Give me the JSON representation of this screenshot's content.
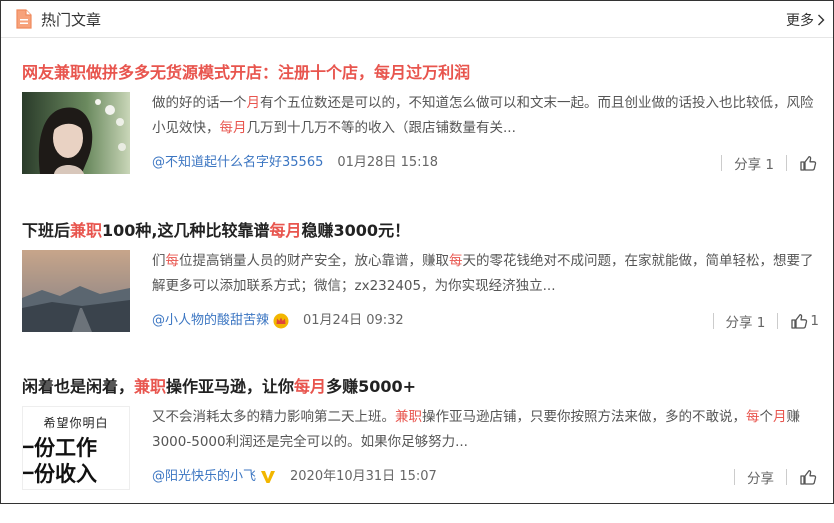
{
  "header": {
    "title": "热门文章",
    "more": "更多"
  },
  "articles": [
    {
      "title_parts": [
        "网友",
        "兼职",
        "做拼多多无货源模式开店：注册十个店，",
        "每月",
        "过万利润"
      ],
      "excerpt_parts": [
        "做的好的话一个",
        "月",
        "有个五位数还是可以的，不知道怎么做可以和文末一起。而且创业做的话投入也比较低，风险小见效快，",
        "每月",
        "几万到十几万不等的收入（跟店铺数量有关..."
      ],
      "author": "@不知道起什么名字好35565",
      "date": "01月28日 15:18",
      "share": "分享 1",
      "likes": ""
    },
    {
      "title_parts": [
        "下班后",
        "兼职",
        "100种,这几种比较靠谱",
        "每月",
        "稳赚3000元！"
      ],
      "excerpt_parts": [
        "们",
        "每",
        "位提高销量人员的财产安全，放心靠谱，赚取",
        "每",
        "天的零花钱绝对不成问题，在家就能做，简单轻松，想要了解更多可以添加联系方式；微信；zx232405，为你实现经济独立..."
      ],
      "author": "@小人物的酸甜苦辣",
      "date": "01月24日 09:32",
      "share": "分享 1",
      "likes": "1"
    },
    {
      "title_parts": [
        "闲着也是闲着，",
        "兼职",
        "操作亚马逊，让你",
        "每月",
        "多赚5000+"
      ],
      "excerpt_parts": [
        "又不会消耗太多的精力影响第二天上班。",
        "兼职",
        "操作亚马逊店铺，只要你按照方法来做，多的不敢说，",
        "每",
        "个",
        "月",
        "赚3000-5000利润还是完全可以的。如果你足够努力..."
      ],
      "thumb_text": [
        "希望你明白",
        "一份工作",
        "一份收入"
      ],
      "author": "@阳光快乐的小飞",
      "date": "2020年10月31日 15:07",
      "share": "分享",
      "likes": ""
    }
  ],
  "colors": {
    "highlight": "#e8554e",
    "author": "#3c76c2",
    "header_icon": "#f08a5d",
    "vip_badge": "#f2b600"
  }
}
